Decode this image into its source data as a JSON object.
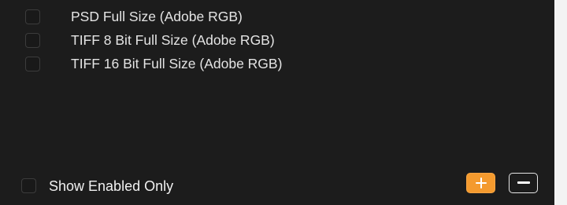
{
  "formats": [
    {
      "label": "PSD Full Size (Adobe RGB)",
      "checked": false
    },
    {
      "label": "TIFF 8 Bit Full Size (Adobe RGB)",
      "checked": false
    },
    {
      "label": "TIFF 16 Bit Full Size (Adobe RGB)",
      "checked": false
    }
  ],
  "footer": {
    "show_enabled_label": "Show Enabled Only",
    "show_enabled_checked": false,
    "add_icon": "plus-icon",
    "remove_icon": "minus-icon"
  },
  "colors": {
    "panel_background": "#1c1c1c",
    "accent": "#f49a2e",
    "text": "#e4e4e4"
  }
}
